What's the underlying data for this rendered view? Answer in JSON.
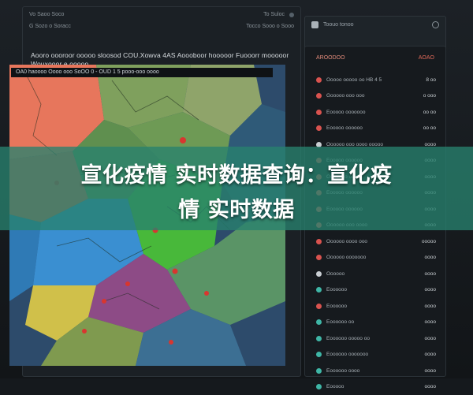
{
  "banner": {
    "line1": "宣化疫情 实时数据查询：宣化疫",
    "line2": "情 实时数据"
  },
  "left_panel": {
    "top_left": "Vo Saoo Soco",
    "top_right": "To Suloc",
    "sub_left": "G Sozo o Soracc",
    "sub_right": "Tocco Sooo o Sooo",
    "title": "Aooro oooroor ooooo sloosod COU.Xowva 4AS Aoooboor hooooor Fuooorr mooooor Wouxooor e ooooo",
    "map_bar": "OA0 haoooo  Oooo ooo SoOO 0 - OUD 1 5 pooo-ooo oooo"
  },
  "right_panel": {
    "header_text": "Toouo tonoo"
  },
  "list": {
    "title_left": "AROODOO",
    "title_right": "AOAO",
    "rows": [
      {
        "label": "Ooooo ooooo oo HB 4 5",
        "value": "8 oo",
        "icon": "red"
      },
      {
        "label": "Gooooo ooo ooo",
        "value": "o ooo",
        "icon": "red"
      },
      {
        "label": "Eooooo ooooooo",
        "value": "oo oo",
        "icon": "red"
      },
      {
        "label": "Eooooo oooooo",
        "value": "oo oo",
        "icon": "red"
      },
      {
        "label": "Oooooo ooo oooo ooooo",
        "value": "oooo",
        "icon": "white"
      },
      {
        "label": "Eooooo oooooo",
        "value": "oooo",
        "icon": "red"
      },
      {
        "label": "Ooooooo ooo",
        "value": "oooo",
        "icon": "red"
      },
      {
        "label": "Eooooo oooooo",
        "value": "oooo",
        "icon": "red"
      },
      {
        "label": "Eooooo oooooo",
        "value": "oooo",
        "icon": "red"
      },
      {
        "label": "Oooooo ooo oooo",
        "value": "oooo",
        "icon": "red"
      },
      {
        "label": "Oooooo oooo ooo",
        "value": "ooooo",
        "icon": "red"
      },
      {
        "label": "Oooooo ooooooo",
        "value": "oooo",
        "icon": "red"
      },
      {
        "label": "Oooooo",
        "value": "oooo",
        "icon": "white"
      },
      {
        "label": "Eoooooo",
        "value": "oooo",
        "icon": "teal"
      },
      {
        "label": "Eoooooo",
        "value": "oooo",
        "icon": "red"
      },
      {
        "label": "Eoooooo oo",
        "value": "oooo",
        "icon": "teal"
      },
      {
        "label": "Eoooooo ooooo oo",
        "value": "oooo",
        "icon": "teal"
      },
      {
        "label": "Eoooooo ooooooo",
        "value": "oooo",
        "icon": "teal"
      },
      {
        "label": "Eoooooo oooo",
        "value": "oooo",
        "icon": "teal"
      },
      {
        "label": "Eooooo",
        "value": "oooo",
        "icon": "teal"
      }
    ]
  },
  "colors": {
    "banner": "#28826e",
    "accent_red": "#d9534f",
    "accent_teal": "#3fb6a6"
  }
}
